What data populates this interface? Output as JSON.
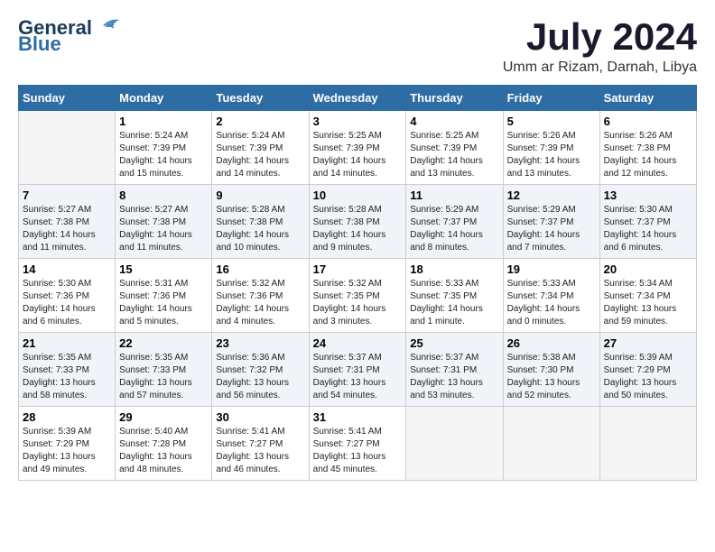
{
  "logo": {
    "line1": "General",
    "line2": "Blue"
  },
  "title": "July 2024",
  "location": "Umm ar Rizam, Darnah, Libya",
  "days_of_week": [
    "Sunday",
    "Monday",
    "Tuesday",
    "Wednesday",
    "Thursday",
    "Friday",
    "Saturday"
  ],
  "weeks": [
    [
      {
        "day": "",
        "empty": true
      },
      {
        "day": "1",
        "sunrise": "5:24 AM",
        "sunset": "7:39 PM",
        "daylight": "14 hours and 15 minutes."
      },
      {
        "day": "2",
        "sunrise": "5:24 AM",
        "sunset": "7:39 PM",
        "daylight": "14 hours and 14 minutes."
      },
      {
        "day": "3",
        "sunrise": "5:25 AM",
        "sunset": "7:39 PM",
        "daylight": "14 hours and 14 minutes."
      },
      {
        "day": "4",
        "sunrise": "5:25 AM",
        "sunset": "7:39 PM",
        "daylight": "14 hours and 13 minutes."
      },
      {
        "day": "5",
        "sunrise": "5:26 AM",
        "sunset": "7:39 PM",
        "daylight": "14 hours and 13 minutes."
      },
      {
        "day": "6",
        "sunrise": "5:26 AM",
        "sunset": "7:38 PM",
        "daylight": "14 hours and 12 minutes."
      }
    ],
    [
      {
        "day": "7",
        "sunrise": "5:27 AM",
        "sunset": "7:38 PM",
        "daylight": "14 hours and 11 minutes."
      },
      {
        "day": "8",
        "sunrise": "5:27 AM",
        "sunset": "7:38 PM",
        "daylight": "14 hours and 11 minutes."
      },
      {
        "day": "9",
        "sunrise": "5:28 AM",
        "sunset": "7:38 PM",
        "daylight": "14 hours and 10 minutes."
      },
      {
        "day": "10",
        "sunrise": "5:28 AM",
        "sunset": "7:38 PM",
        "daylight": "14 hours and 9 minutes."
      },
      {
        "day": "11",
        "sunrise": "5:29 AM",
        "sunset": "7:37 PM",
        "daylight": "14 hours and 8 minutes."
      },
      {
        "day": "12",
        "sunrise": "5:29 AM",
        "sunset": "7:37 PM",
        "daylight": "14 hours and 7 minutes."
      },
      {
        "day": "13",
        "sunrise": "5:30 AM",
        "sunset": "7:37 PM",
        "daylight": "14 hours and 6 minutes."
      }
    ],
    [
      {
        "day": "14",
        "sunrise": "5:30 AM",
        "sunset": "7:36 PM",
        "daylight": "14 hours and 6 minutes."
      },
      {
        "day": "15",
        "sunrise": "5:31 AM",
        "sunset": "7:36 PM",
        "daylight": "14 hours and 5 minutes."
      },
      {
        "day": "16",
        "sunrise": "5:32 AM",
        "sunset": "7:36 PM",
        "daylight": "14 hours and 4 minutes."
      },
      {
        "day": "17",
        "sunrise": "5:32 AM",
        "sunset": "7:35 PM",
        "daylight": "14 hours and 3 minutes."
      },
      {
        "day": "18",
        "sunrise": "5:33 AM",
        "sunset": "7:35 PM",
        "daylight": "14 hours and 1 minute."
      },
      {
        "day": "19",
        "sunrise": "5:33 AM",
        "sunset": "7:34 PM",
        "daylight": "14 hours and 0 minutes."
      },
      {
        "day": "20",
        "sunrise": "5:34 AM",
        "sunset": "7:34 PM",
        "daylight": "13 hours and 59 minutes."
      }
    ],
    [
      {
        "day": "21",
        "sunrise": "5:35 AM",
        "sunset": "7:33 PM",
        "daylight": "13 hours and 58 minutes."
      },
      {
        "day": "22",
        "sunrise": "5:35 AM",
        "sunset": "7:33 PM",
        "daylight": "13 hours and 57 minutes."
      },
      {
        "day": "23",
        "sunrise": "5:36 AM",
        "sunset": "7:32 PM",
        "daylight": "13 hours and 56 minutes."
      },
      {
        "day": "24",
        "sunrise": "5:37 AM",
        "sunset": "7:31 PM",
        "daylight": "13 hours and 54 minutes."
      },
      {
        "day": "25",
        "sunrise": "5:37 AM",
        "sunset": "7:31 PM",
        "daylight": "13 hours and 53 minutes."
      },
      {
        "day": "26",
        "sunrise": "5:38 AM",
        "sunset": "7:30 PM",
        "daylight": "13 hours and 52 minutes."
      },
      {
        "day": "27",
        "sunrise": "5:39 AM",
        "sunset": "7:29 PM",
        "daylight": "13 hours and 50 minutes."
      }
    ],
    [
      {
        "day": "28",
        "sunrise": "5:39 AM",
        "sunset": "7:29 PM",
        "daylight": "13 hours and 49 minutes."
      },
      {
        "day": "29",
        "sunrise": "5:40 AM",
        "sunset": "7:28 PM",
        "daylight": "13 hours and 48 minutes."
      },
      {
        "day": "30",
        "sunrise": "5:41 AM",
        "sunset": "7:27 PM",
        "daylight": "13 hours and 46 minutes."
      },
      {
        "day": "31",
        "sunrise": "5:41 AM",
        "sunset": "7:27 PM",
        "daylight": "13 hours and 45 minutes."
      },
      {
        "day": "",
        "empty": true
      },
      {
        "day": "",
        "empty": true
      },
      {
        "day": "",
        "empty": true
      }
    ]
  ]
}
